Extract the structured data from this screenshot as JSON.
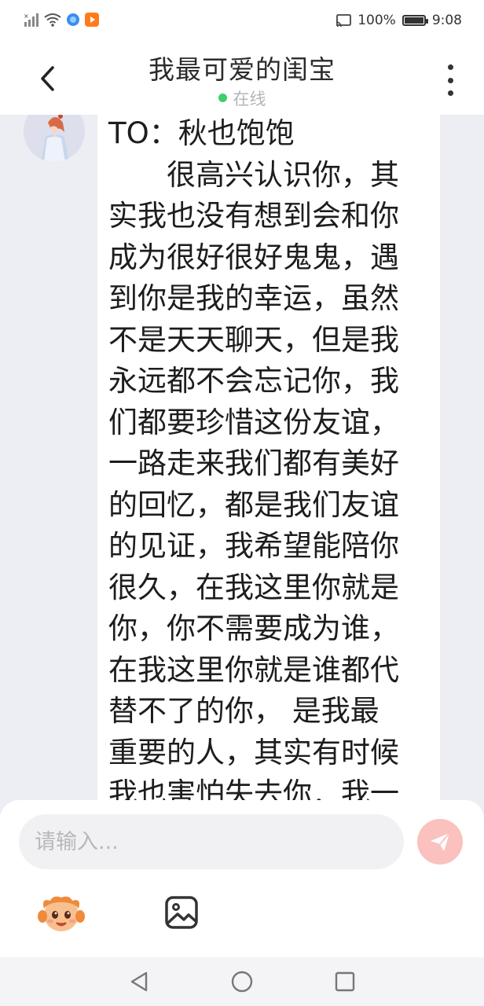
{
  "status_bar": {
    "battery": "100%",
    "time": "9:08"
  },
  "header": {
    "title": "我最可爱的闺宝",
    "status": "在线",
    "status_color": "#3ccf6a"
  },
  "message": {
    "lines": [
      "TO：秋也饱饱",
      "　　很高兴认识你，其",
      "实我也没有想到会和你",
      "成为很好很好鬼鬼，遇",
      "到你是我的幸运，虽然",
      "不是天天聊天，但是我",
      "永远都不会忘记你，我",
      "们都要珍惜这份友谊，",
      "一路走来我们都有美好",
      "的回忆，都是我们友谊",
      "的见证，我希望能陪你",
      "很久，在我这里你就是",
      "你，你不需要成为谁，",
      "在我这里你就是谁都代",
      "替不了的你， 是我最",
      "重要的人，其实有时候",
      "我也害怕失去你．我一"
    ]
  },
  "composer": {
    "placeholder": "请输入...",
    "value": "",
    "send_icon": "send-icon",
    "emoji_icon": "emoji-icon",
    "image_icon": "image-icon",
    "accent": "#fbc1be"
  },
  "nav": {
    "back_icon": "triangle-back-icon",
    "home_icon": "circle-home-icon",
    "recents_icon": "square-recents-icon"
  }
}
